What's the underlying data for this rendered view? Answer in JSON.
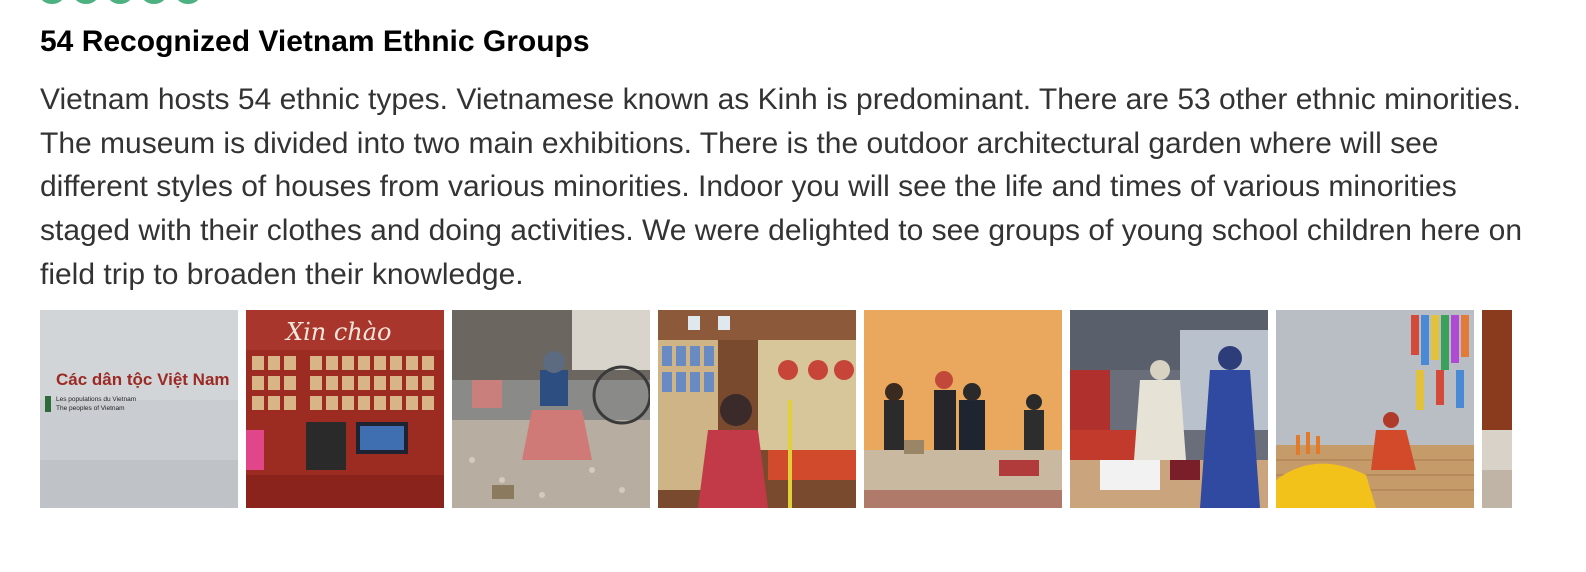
{
  "review": {
    "rating": {
      "bubbles": 5,
      "color": "#2fa36b"
    },
    "title": "54 Recognized Vietnam Ethnic Groups",
    "body": "Vietnam hosts 54 ethnic types. Vietnamese known as Kinh is predominant. There are 53 other ethnic minorities. The museum is divided into two main exhibitions. There is the outdoor architectural garden where will see different styles of houses from various minorities. Indoor you will see the life and times of various minorities staged with their clothes and doing activities. We were delighted to see groups of young school children here on field trip to broaden their knowledge."
  },
  "photos": {
    "items": [
      {
        "icon": "photo-sign-wall",
        "sign_title": "Các dân tộc Việt Nam",
        "sign_line1": "Les populations du Vietnam",
        "sign_line2": "The peoples of Vietnam"
      },
      {
        "icon": "photo-xin-chao-wall",
        "caption": "Xin chào"
      },
      {
        "icon": "photo-weaver-figure"
      },
      {
        "icon": "photo-ceremony-figures"
      },
      {
        "icon": "photo-village-figures"
      },
      {
        "icon": "photo-textiles-figures"
      },
      {
        "icon": "photo-colorful-display"
      },
      {
        "icon": "photo-partial-next"
      }
    ]
  }
}
